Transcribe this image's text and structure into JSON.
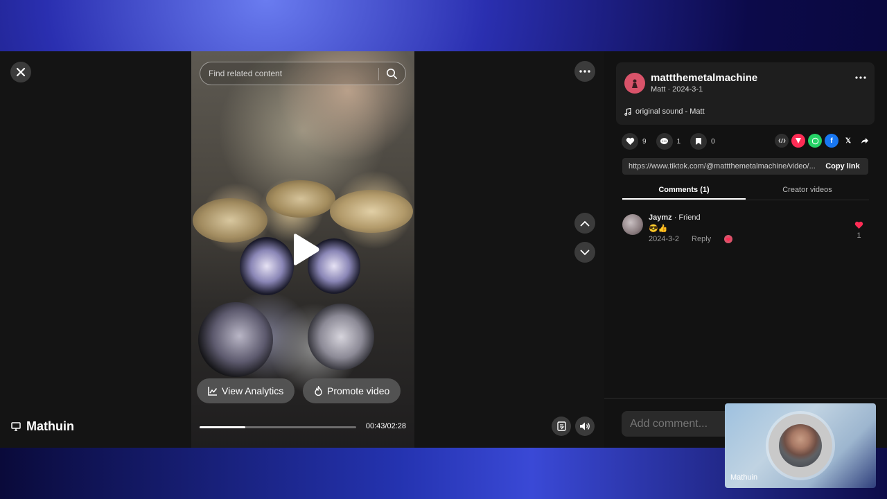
{
  "window": {
    "presenter_name": "Mathuin",
    "camera_name": "Mathuin"
  },
  "video": {
    "search_placeholder": "Find related content",
    "view_analytics_label": "View Analytics",
    "promote_video_label": "Promote video",
    "time": "00:43/02:28",
    "progress": 0.29
  },
  "post": {
    "username": "mattthemetalmachine",
    "subline": "Matt · 2024-3-1",
    "sound": "original sound - Matt",
    "likes": "9",
    "comments": "1",
    "saves": "0",
    "link": "https://www.tiktok.com/@mattthemetalmachine/video/...",
    "copy_link_label": "Copy link"
  },
  "tabs": [
    {
      "label": "Comments (1)",
      "active": true
    },
    {
      "label": "Creator videos",
      "active": false
    }
  ],
  "comments": [
    {
      "author": "Jaymz",
      "relation": "· Friend",
      "text": "😎👍",
      "date": "2024-3-2",
      "reply_label": "Reply",
      "likes": "1"
    }
  ],
  "composer": {
    "placeholder": "Add comment..."
  },
  "colors": {
    "accent_like": "#fe2c55",
    "avatar_user": "#d9536a"
  }
}
